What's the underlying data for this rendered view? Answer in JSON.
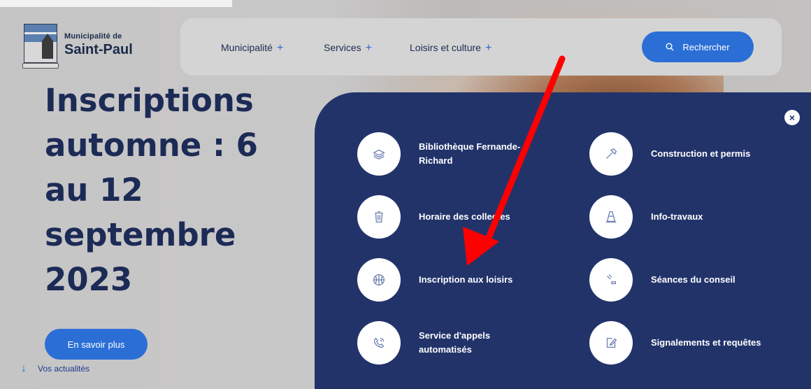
{
  "logo": {
    "line1": "Municipalité de",
    "line2": "Saint-Paul"
  },
  "nav": {
    "items": [
      {
        "label": "Municipalité",
        "plus": "+"
      },
      {
        "label": "Services",
        "plus": "+"
      },
      {
        "label": "Loisirs et culture",
        "plus": "+"
      }
    ],
    "search_label": "Rechercher"
  },
  "hero": {
    "title_lines": [
      "Inscriptions",
      "automne : 6",
      "au 12",
      "septembre",
      "2023"
    ],
    "button_label": "En savoir plus",
    "news_label": "Vos actualités"
  },
  "panel": {
    "close_glyph": "×",
    "services": [
      {
        "label": "Bibliothèque Fernande-Richard",
        "icon": "books-icon"
      },
      {
        "label": "Construction et permis",
        "icon": "hammer-icon"
      },
      {
        "label": "Horaire des collectes",
        "icon": "trash-icon"
      },
      {
        "label": "Info-travaux",
        "icon": "traffic-cone-icon"
      },
      {
        "label": "Inscription aux loisirs",
        "icon": "basketball-icon"
      },
      {
        "label": "Séances du conseil",
        "icon": "gavel-icon"
      },
      {
        "label": "Service d'appels automatisés",
        "icon": "phone-call-icon"
      },
      {
        "label": "Signalements et requêtes",
        "icon": "edit-form-icon"
      }
    ]
  },
  "colors": {
    "panel": "#22336a",
    "accent": "#2b6fd6",
    "title": "#1c2b56",
    "annotation": "#ff0000"
  }
}
